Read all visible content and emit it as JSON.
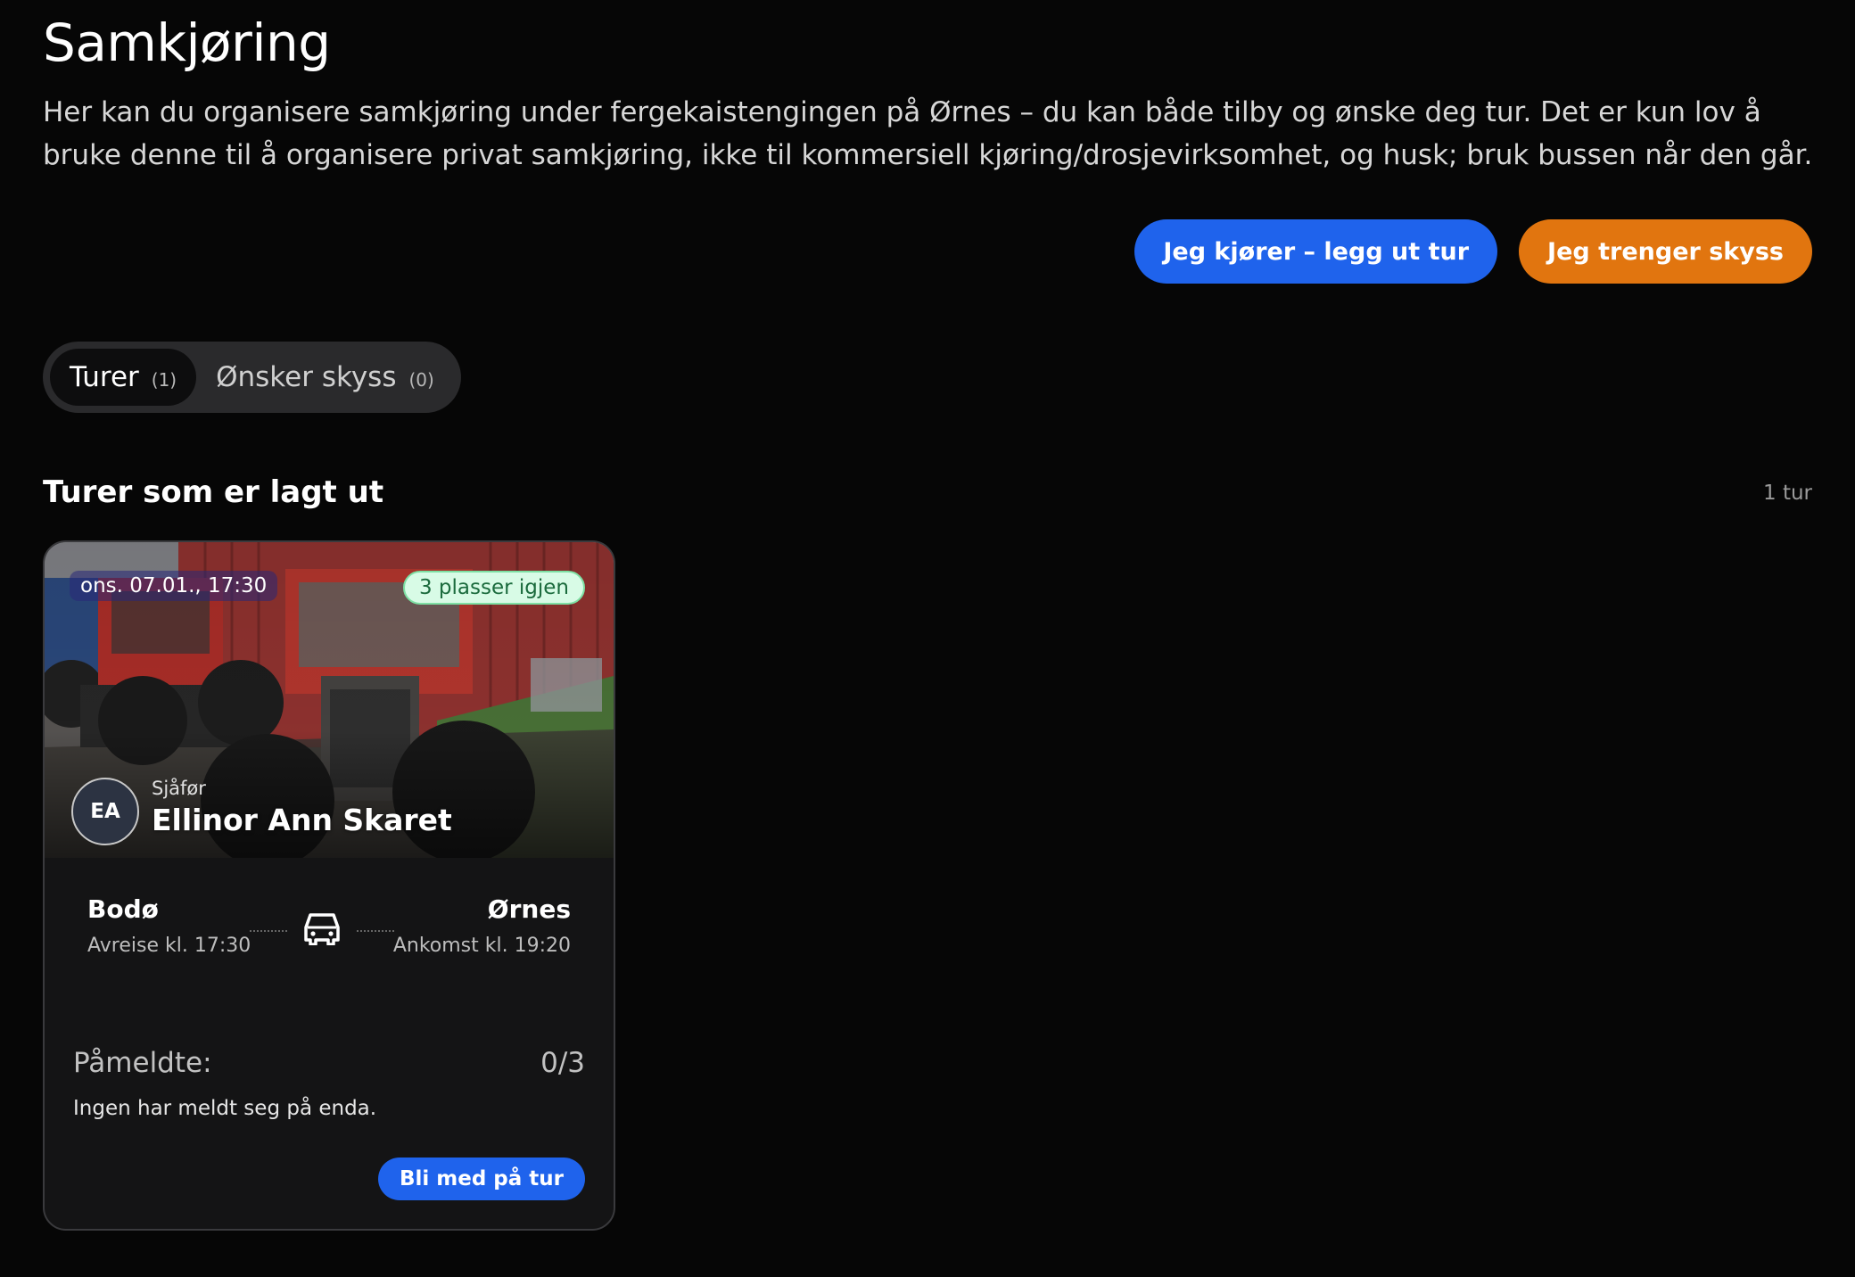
{
  "page": {
    "title": "Samkjøring",
    "intro": "Her kan du organisere samkjøring under fergekaistengingen på Ørnes – du kan både tilby og ønske deg tur. Det er kun lov å bruke denne til å organisere privat samkjøring, ikke til kommersiell kjøring/drosjevirksomhet, og husk; bruk bussen når den går."
  },
  "actions": {
    "offer_label": "Jeg kjører – legg ut tur",
    "request_label": "Jeg trenger skyss"
  },
  "tabs": [
    {
      "label": "Turer",
      "count": "(1)",
      "active": true
    },
    {
      "label": "Ønsker skyss",
      "count": "(0)",
      "active": false
    }
  ],
  "section": {
    "title": "Turer som er lagt ut",
    "count_label": "1 tur"
  },
  "trip": {
    "date": "ons. 07.01., 17:30",
    "seats_badge": "3 plasser igjen",
    "driver_initials": "EA",
    "driver_role": "Sjåfør",
    "driver_name": "Ellinor Ann Skaret",
    "from_city": "Bodø",
    "from_time": "Avreise kl. 17:30",
    "to_city": "Ørnes",
    "to_time": "Ankomst kl. 19:20",
    "registered_label": "Påmeldte:",
    "registered_count": "0/3",
    "registered_text": "Ingen har meldt seg på enda.",
    "join_label": "Bli med på tur"
  },
  "icons": {
    "car": "car-icon"
  },
  "colors": {
    "primary_blue": "#1f63ec",
    "accent_orange": "#e1750f",
    "badge_green_bg": "#d8fbe6",
    "background": "#060606",
    "card_bg": "#141415"
  }
}
